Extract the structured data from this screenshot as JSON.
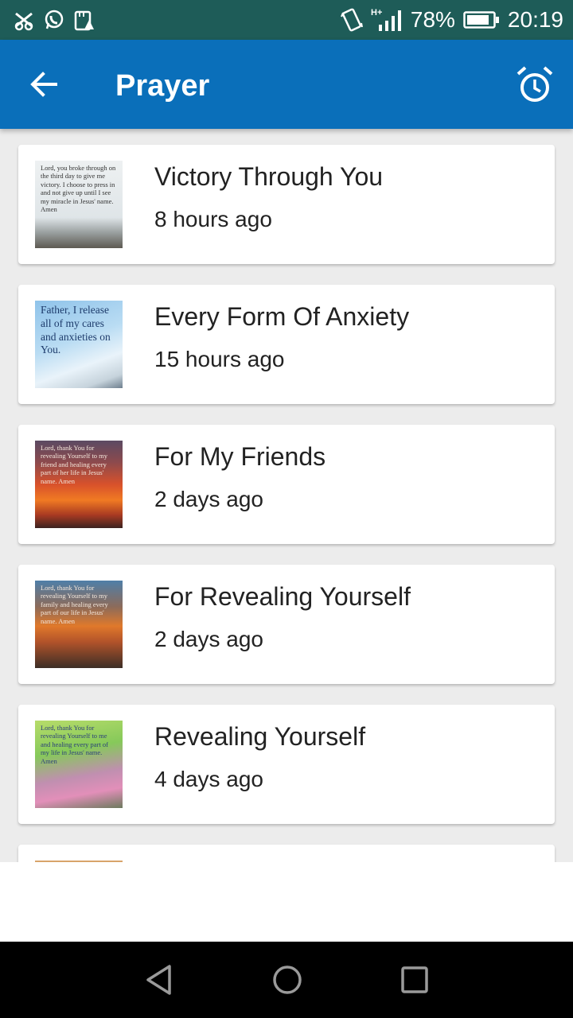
{
  "status_bar": {
    "battery": "78%",
    "time": "20:19",
    "network": "H+",
    "icons": [
      "signal-off-icon",
      "whatsapp-icon",
      "storage-warning-icon",
      "vibrate-icon",
      "cell-signal-icon",
      "battery-icon"
    ]
  },
  "app_bar": {
    "title": "Prayer",
    "back_icon": "arrow-back-icon",
    "alarm_icon": "alarm-clock-icon",
    "color": "#0a6fba"
  },
  "items": [
    {
      "title": "Victory Through You",
      "time": "8 hours ago",
      "thumb_text": "Lord, you broke through on the third day to give me victory. I choose to press in and not give up until I see my miracle in Jesus' name. Amen"
    },
    {
      "title": "Every Form Of Anxiety",
      "time": "15 hours ago",
      "thumb_text": "Father, I release all of my cares and anxieties on You."
    },
    {
      "title": "For My Friends",
      "time": "2 days ago",
      "thumb_text": "Lord, thank You for revealing Yourself to my friend and healing every part of her life in Jesus' name. Amen"
    },
    {
      "title": "For Revealing Yourself",
      "time": "2 days ago",
      "thumb_text": "Lord, thank You for revealing Yourself to my family and healing every part of our life in Jesus' name. Amen"
    },
    {
      "title": "Revealing Yourself",
      "time": "4 days ago",
      "thumb_text": "Lord, thank You for revealing Yourself to me and healing every part of my life in Jesus' name. Amen"
    }
  ],
  "nav_bar": {
    "icons": [
      "nav-back-icon",
      "nav-home-icon",
      "nav-recents-icon"
    ]
  }
}
